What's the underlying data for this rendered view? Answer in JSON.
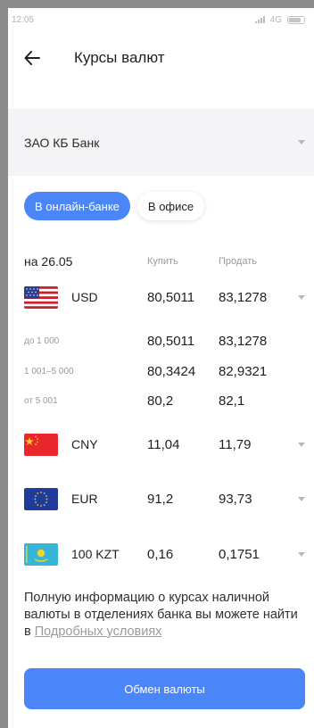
{
  "statusbar": {
    "time": "12:05",
    "network": "4G"
  },
  "header": {
    "title": "Курсы валют"
  },
  "bank_select": {
    "value": "ЗАО КБ Банк"
  },
  "tabs": [
    {
      "label": "В онлайн-банке",
      "active": true
    },
    {
      "label": "В офисе",
      "active": false
    }
  ],
  "table": {
    "date_label": "на 26.05",
    "buy_header": "Купить",
    "sell_header": "Продать",
    "usd": {
      "code": "USD",
      "buy": "80,5011",
      "sell": "83,1278",
      "tiers": [
        {
          "label": "до 1 000",
          "buy": "80,5011",
          "sell": "83,1278"
        },
        {
          "label": "1 001–5 000",
          "buy": "80,3424",
          "sell": "82,9321"
        },
        {
          "label": "от 5 001",
          "buy": "80,2",
          "sell": "82,1"
        }
      ]
    },
    "cny": {
      "code": "CNY",
      "buy": "11,04",
      "sell": "11,79"
    },
    "eur": {
      "code": "EUR",
      "buy": "91,2",
      "sell": "93,73"
    },
    "kzt": {
      "code": "100 KZT",
      "buy": "0,16",
      "sell": "0,1751"
    }
  },
  "info": {
    "text": "Полную информацию о курсах наличной валюты в отделениях банка вы можете найти в ",
    "link": "Подробных условиях"
  },
  "cta": {
    "label": "Обмен валюты"
  },
  "colors": {
    "accent": "#4a86f7",
    "select_bg": "#f4f4f6"
  }
}
